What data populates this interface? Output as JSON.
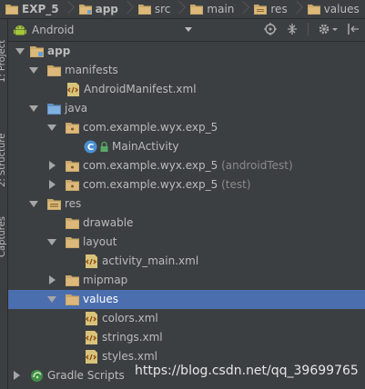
{
  "breadcrumb": [
    {
      "label": "EXP_5",
      "bold": true
    },
    {
      "label": "app",
      "bold": true
    },
    {
      "label": "src",
      "bold": false
    },
    {
      "label": "main",
      "bold": false
    },
    {
      "label": "res",
      "bold": false
    },
    {
      "label": "values",
      "bold": false
    }
  ],
  "left_strip": {
    "tab1": "1: Project",
    "tab2": "2: Structure",
    "tab3": "Captures"
  },
  "panel": {
    "view_mode": "Android"
  },
  "tree": [
    {
      "label": "app",
      "suffix": "",
      "icon": "module-folder-icon",
      "expanded": true,
      "bold": true
    },
    {
      "label": "manifests",
      "suffix": "",
      "icon": "folder-icon",
      "expanded": true
    },
    {
      "label": "AndroidManifest.xml",
      "suffix": "",
      "icon": "xml-file-icon"
    },
    {
      "label": "java",
      "suffix": "",
      "icon": "source-folder-icon",
      "expanded": true
    },
    {
      "label": "com.example.wyx.exp_5",
      "suffix": "",
      "icon": "package-icon",
      "expanded": true
    },
    {
      "label": "MainActivity",
      "suffix": "",
      "icon": "class-icon"
    },
    {
      "label": "com.example.wyx.exp_5",
      "suffix": "(androidTest)",
      "icon": "package-icon",
      "expanded": false
    },
    {
      "label": "com.example.wyx.exp_5",
      "suffix": "(test)",
      "icon": "package-icon",
      "expanded": false
    },
    {
      "label": "res",
      "suffix": "",
      "icon": "resource-folder-icon",
      "expanded": true
    },
    {
      "label": "drawable",
      "suffix": "",
      "icon": "folder-icon"
    },
    {
      "label": "layout",
      "suffix": "",
      "icon": "folder-icon",
      "expanded": true
    },
    {
      "label": "activity_main.xml",
      "suffix": "",
      "icon": "xml-file-icon"
    },
    {
      "label": "mipmap",
      "suffix": "",
      "icon": "folder-icon",
      "expanded": false
    },
    {
      "label": "values",
      "suffix": "",
      "icon": "folder-icon",
      "expanded": true,
      "selected": true
    },
    {
      "label": "colors.xml",
      "suffix": "",
      "icon": "xml-file-icon"
    },
    {
      "label": "strings.xml",
      "suffix": "",
      "icon": "xml-file-icon"
    },
    {
      "label": "styles.xml",
      "suffix": "",
      "icon": "xml-file-icon"
    },
    {
      "label": "Gradle Scripts",
      "suffix": "",
      "icon": "gradle-icon",
      "expanded": false
    }
  ],
  "watermark": "https://blog.csdn.net/qq_39699765",
  "colors": {
    "background": "#3c3f41",
    "selection": "#4b6eaf",
    "text": "#bbbbbb",
    "folder": "#c9a86a",
    "java_folder": "#6a9fd8",
    "android_green": "#a4c639"
  }
}
